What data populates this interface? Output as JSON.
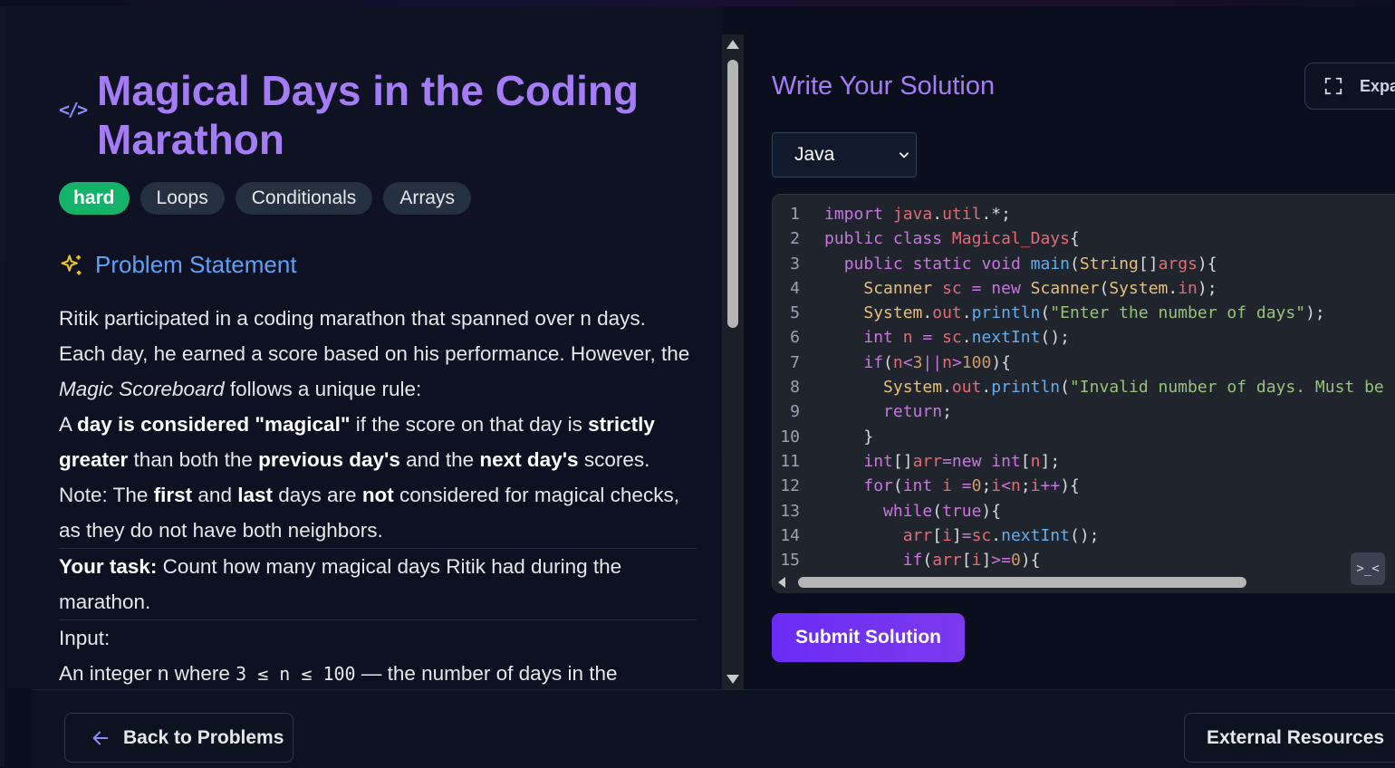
{
  "problem": {
    "title": "Magical Days in the Coding Marathon",
    "difficulty": "hard",
    "tags": [
      "Loops",
      "Conditionals",
      "Arrays"
    ],
    "section_heading": "Problem Statement",
    "p1_pre": "Ritik participated in a coding marathon that spanned over n days. Each day, he earned a score based on his performance. However, the ",
    "p1_em": "Magic Scoreboard",
    "p1_post": " follows a unique rule:",
    "p2_a": "A ",
    "p2_b": "day is considered \"magical\"",
    "p2_c": " if the score on that day is ",
    "p2_d": "strictly greater",
    "p2_e": " than both the ",
    "p2_f": "previous day's",
    "p2_g": " and the ",
    "p2_h": "next day's",
    "p2_i": " scores.",
    "p3_a": "Note: The ",
    "p3_b": "first",
    "p3_c": " and ",
    "p3_d": "last",
    "p3_e": " days are ",
    "p3_f": "not",
    "p3_g": " considered for magical checks, as they do not have both neighbors.",
    "task_label": "Your task:",
    "task_text": " Count how many magical days Ritik had during the marathon.",
    "input_label": "Input:",
    "input_pre": "An integer n where ",
    "input_code": "3 ≤ n ≤ 100",
    "input_post": " — the number of days in the"
  },
  "editor": {
    "heading": "Write Your Solution",
    "expand_label": "Expa",
    "language": "Java",
    "line_numbers": [
      "1",
      "2",
      "3",
      "4",
      "5",
      "6",
      "7",
      "8",
      "9",
      "10",
      "11",
      "12",
      "13",
      "14",
      "15"
    ],
    "code_lines": [
      "import java.util.*;",
      "public class Magical_Days{",
      "  public static void main(String[]args){",
      "    Scanner sc = new Scanner(System.in);",
      "    System.out.println(\"Enter the number of days\");",
      "    int n = sc.nextInt();",
      "    if(n<3||n>100){",
      "      System.out.println(\"Invalid number of days. Must be b",
      "      return;",
      "    }",
      "    int[]arr=new int[n];",
      "    for(int i =0;i<n;i++){",
      "      while(true){",
      "        arr[i]=sc.nextInt();",
      "        if(arr[i]>=0){"
    ],
    "terminal_icon_text": ">_<",
    "submit_label": "Submit Solution"
  },
  "footer": {
    "back_label": "Back to Problems",
    "external_label": "External Resources"
  },
  "colors": {
    "accent_purple": "#a47cf5",
    "accent_blue": "#5fa0f7",
    "difficulty_hard": "#15b36a",
    "submit": "#7c3aed",
    "background": "#0b0f1d"
  }
}
